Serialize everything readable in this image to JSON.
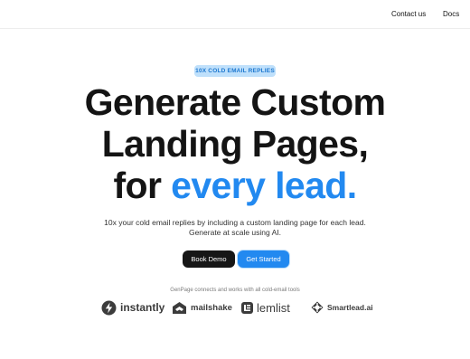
{
  "nav": {
    "contact_label": "Contact us",
    "docs_label": "Docs"
  },
  "hero": {
    "badge": "10X COLD EMAIL REPLIES",
    "headline_line1": "Generate Custom",
    "headline_line2": "Landing Pages,",
    "headline_line3_prefix": "for ",
    "headline_line3_accent": "every lead.",
    "subtitle_line1": "10x your cold email replies by including a custom landing page for each lead.",
    "subtitle_line2": "Generate at scale using AI.",
    "book_demo_label": "Book Demo",
    "get_started_label": "Get Started"
  },
  "integrations": {
    "caption": "GenPage connects and works with all cold-email tools",
    "logos": [
      {
        "name": "instantly",
        "icon": "lightning-bolt-icon"
      },
      {
        "name": "mailshake",
        "icon": "handshake-icon"
      },
      {
        "name": "lemlist",
        "icon": "lemlist-icon"
      },
      {
        "name": "Smartlead.ai",
        "icon": "smartlead-icon"
      }
    ]
  },
  "colors": {
    "accent": "#2289f0",
    "badge_bg": "#bfe0fb",
    "dark_button": "#161616",
    "text": "#141414"
  }
}
